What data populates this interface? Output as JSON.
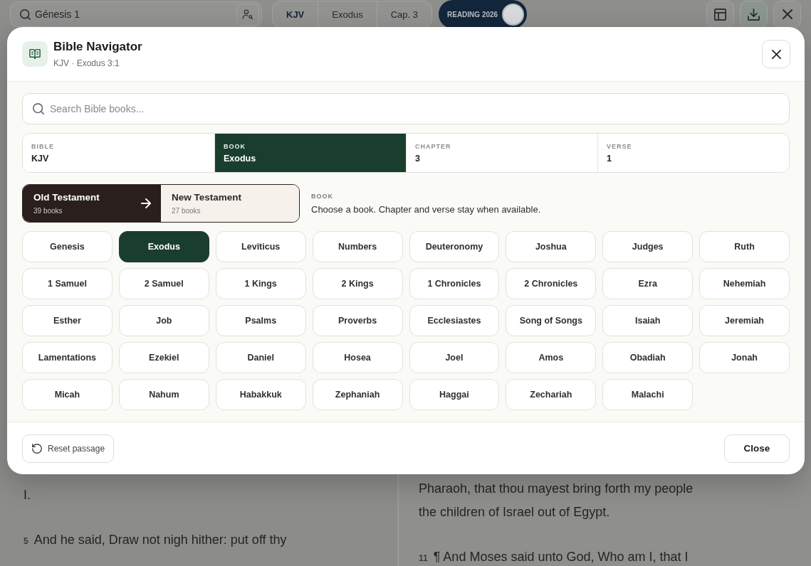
{
  "top_bar": {
    "search": {
      "value": "Génesis 1"
    },
    "segments": [
      {
        "label": "KJV",
        "selected": true
      },
      {
        "label": "Exodus",
        "selected": false
      },
      {
        "label": "Cap. 3",
        "selected": false
      }
    ],
    "reading_toggle": {
      "label": "READING 2026",
      "on": true
    }
  },
  "reader": {
    "left_column": [
      {
        "text": "I."
      },
      {
        "verse": "5",
        "text": "And he said, Draw not nigh hither: put off thy"
      }
    ],
    "right_column": [
      {
        "text": "Pharaoh, that thou mayest bring forth my people the children of Israel out of Egypt."
      },
      {
        "verse": "11",
        "text": "¶ And Moses said unto God, Who am I, that I"
      }
    ]
  },
  "dialog": {
    "title": "Bible Navigator",
    "subtitle": "KJV · Exodus 3:1",
    "search": {
      "placeholder": "Search Bible books..."
    },
    "selectors": [
      {
        "label": "BIBLE",
        "value": "KJV",
        "selected": false
      },
      {
        "label": "BOOK",
        "value": "Exodus",
        "selected": true
      },
      {
        "label": "CHAPTER",
        "value": "3",
        "selected": false
      },
      {
        "label": "VERSE",
        "value": "1",
        "selected": false
      }
    ],
    "testaments": [
      {
        "name": "Old Testament",
        "count": "39 books",
        "selected": true
      },
      {
        "name": "New Testament",
        "count": "27 books",
        "selected": false
      }
    ],
    "hint": {
      "label": "BOOK",
      "text": "Choose a book. Chapter and verse stay when available."
    },
    "books": [
      {
        "name": "Genesis",
        "selected": false
      },
      {
        "name": "Exodus",
        "selected": true
      },
      {
        "name": "Leviticus",
        "selected": false
      },
      {
        "name": "Numbers",
        "selected": false
      },
      {
        "name": "Deuteronomy",
        "selected": false
      },
      {
        "name": "Joshua",
        "selected": false
      },
      {
        "name": "Judges",
        "selected": false
      },
      {
        "name": "Ruth",
        "selected": false
      },
      {
        "name": "1 Samuel",
        "selected": false
      },
      {
        "name": "2 Samuel",
        "selected": false
      },
      {
        "name": "1 Kings",
        "selected": false
      },
      {
        "name": "2 Kings",
        "selected": false
      },
      {
        "name": "1 Chronicles",
        "selected": false
      },
      {
        "name": "2 Chronicles",
        "selected": false
      },
      {
        "name": "Ezra",
        "selected": false
      },
      {
        "name": "Nehemiah",
        "selected": false
      },
      {
        "name": "Esther",
        "selected": false
      },
      {
        "name": "Job",
        "selected": false
      },
      {
        "name": "Psalms",
        "selected": false
      },
      {
        "name": "Proverbs",
        "selected": false
      },
      {
        "name": "Ecclesiastes",
        "selected": false
      },
      {
        "name": "Song of Songs",
        "selected": false
      },
      {
        "name": "Isaiah",
        "selected": false
      },
      {
        "name": "Jeremiah",
        "selected": false
      },
      {
        "name": "Lamentations",
        "selected": false
      },
      {
        "name": "Ezekiel",
        "selected": false
      },
      {
        "name": "Daniel",
        "selected": false
      },
      {
        "name": "Hosea",
        "selected": false
      },
      {
        "name": "Joel",
        "selected": false
      },
      {
        "name": "Amos",
        "selected": false
      },
      {
        "name": "Obadiah",
        "selected": false
      },
      {
        "name": "Jonah",
        "selected": false
      },
      {
        "name": "Micah",
        "selected": false
      },
      {
        "name": "Nahum",
        "selected": false
      },
      {
        "name": "Habakkuk",
        "selected": false
      },
      {
        "name": "Zephaniah",
        "selected": false
      },
      {
        "name": "Haggai",
        "selected": false
      },
      {
        "name": "Zechariah",
        "selected": false
      },
      {
        "name": "Malachi",
        "selected": false
      }
    ],
    "footer": {
      "reset": "Reset passage",
      "close": "Close"
    }
  }
}
